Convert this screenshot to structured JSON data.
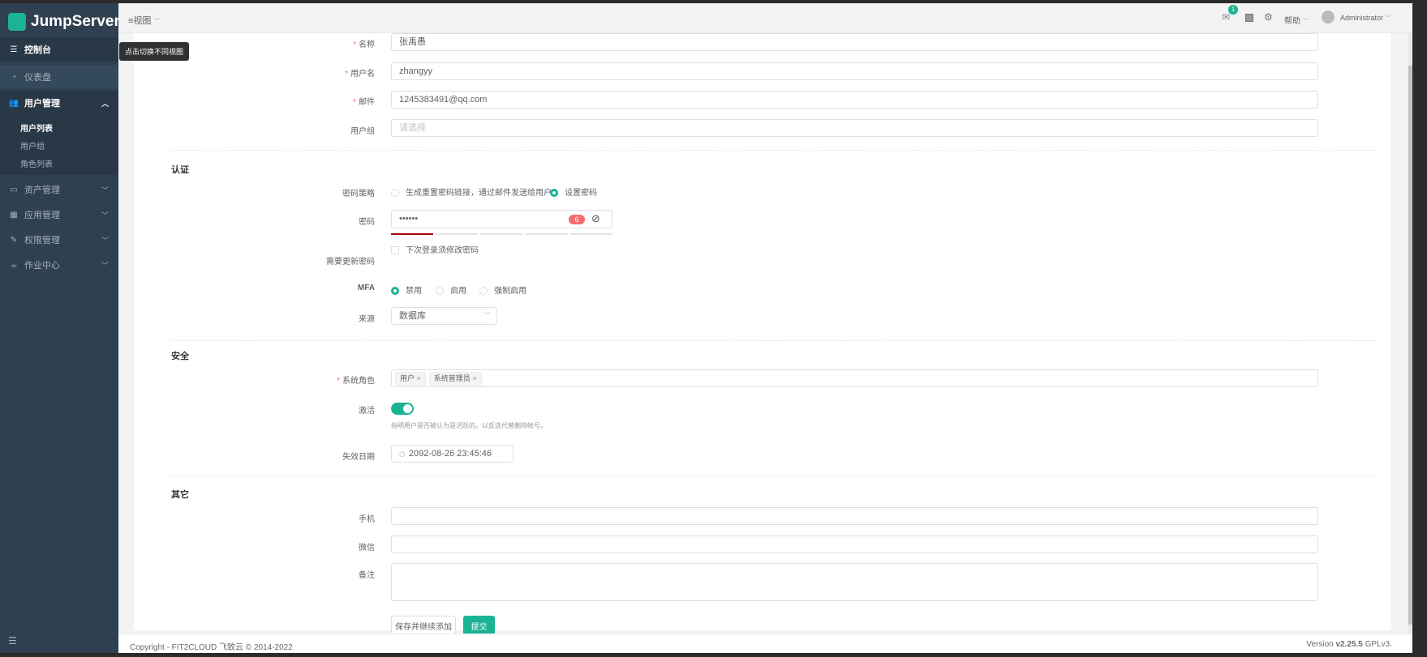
{
  "brand": {
    "name": "JumpServer"
  },
  "sidebar": {
    "console": "控制台",
    "items": [
      {
        "label": "仪表盘",
        "icon": "dashboard-icon"
      },
      {
        "label": "用户管理",
        "icon": "users-icon",
        "expanded": true,
        "children": [
          "用户列表",
          "用户组",
          "角色列表"
        ],
        "active_child": "用户列表"
      },
      {
        "label": "资产管理",
        "icon": "inbox-icon"
      },
      {
        "label": "应用管理",
        "icon": "grid-icon"
      },
      {
        "label": "权限管理",
        "icon": "edit-icon"
      },
      {
        "label": "作业中心",
        "icon": "coffee-icon"
      }
    ]
  },
  "topbar": {
    "view_label": "视图",
    "tooltip": "点击切换不同视图",
    "notification_count": "1",
    "help": "帮助",
    "user": "Administrator"
  },
  "form": {
    "name": {
      "label": "名称",
      "value": "张禹愚",
      "required": true
    },
    "username": {
      "label": "用户名",
      "value": "zhangyy",
      "required": true
    },
    "email": {
      "label": "邮件",
      "value": "1245383491@qq.com",
      "required": true
    },
    "groups": {
      "label": "用户组",
      "placeholder": "请选择"
    },
    "auth_section": "认证",
    "password_strategy": {
      "label": "密码策略",
      "options": [
        "生成重置密码链接，通过邮件发送给用户",
        "设置密码"
      ],
      "selected": "设置密码"
    },
    "password": {
      "label": "密码",
      "value": "••••••",
      "length_badge": "6",
      "strength_level": 1,
      "strength_segments": 5,
      "strength_color": "#a30000"
    },
    "need_update": {
      "label": "需要更新密码",
      "checkbox_label": "下次登录须修改密码",
      "checked": false
    },
    "mfa": {
      "label": "MFA",
      "options": [
        "禁用",
        "启用",
        "强制启用"
      ],
      "selected": "禁用"
    },
    "source": {
      "label": "来源",
      "value": "数据库"
    },
    "security_section": "安全",
    "roles": {
      "label": "系统角色",
      "required": true,
      "tags": [
        "用户",
        "系统管理员"
      ]
    },
    "active": {
      "label": "激活",
      "on": true,
      "help": "指明用户是否被认为是活跃的。以反选代替删除帐号。"
    },
    "expiry": {
      "label": "失效日期",
      "value": "2092-08-26 23:45:46"
    },
    "other_section": "其它",
    "phone": {
      "label": "手机",
      "value": ""
    },
    "wechat": {
      "label": "微信",
      "value": ""
    },
    "comment": {
      "label": "备注",
      "value": ""
    },
    "save_continue": "保存并继续添加",
    "submit": "提交"
  },
  "footer": {
    "copyright": "Copyright - FIT2CLOUD 飞致云 © 2014-2022",
    "version_prefix": "Version ",
    "version": "v2.25.5",
    "license": " GPLv3."
  },
  "colors": {
    "accent": "#1ab394",
    "sidebar": "#2f4050",
    "danger": "#f56c6c"
  }
}
